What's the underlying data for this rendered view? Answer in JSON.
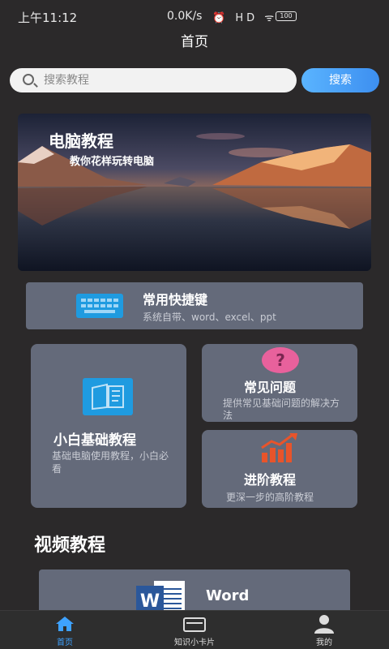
{
  "status_bar": {
    "time": "上午11:12",
    "network_speed": "0.0K/s",
    "icons": "⏰ HD ᯤ",
    "battery": "100"
  },
  "header": {
    "title": "首页"
  },
  "search": {
    "placeholder": "搜索教程",
    "button_label": "搜索"
  },
  "banner": {
    "title": "电脑教程",
    "subtitle": "教你花样玩转电脑"
  },
  "shortcuts_card": {
    "title": "常用快捷键",
    "subtitle": "系统自带、word、excel、ppt",
    "icon": "keyboard-icon"
  },
  "basics_card": {
    "title": "小白基础教程",
    "subtitle": "基础电脑使用教程，小白必看",
    "icon": "book-icon"
  },
  "faq_card": {
    "title": "常见问题",
    "subtitle": "提供常见基础问题的解决方法",
    "icon": "question-icon",
    "icon_glyph": "?"
  },
  "advanced_card": {
    "title": "进阶教程",
    "subtitle": "更深一步的高阶教程",
    "icon": "chart-icon"
  },
  "video_section": {
    "title": "视频教程",
    "items": [
      {
        "label": "Word",
        "icon": "word-icon"
      }
    ]
  },
  "tabbar": {
    "items": [
      {
        "label": "首页",
        "icon": "home-icon",
        "active": true
      },
      {
        "label": "知识小卡片",
        "icon": "card-icon",
        "active": false
      },
      {
        "label": "我的",
        "icon": "user-icon",
        "active": false
      }
    ]
  },
  "colors": {
    "accent": "#3ea2ff",
    "card": "#646a7a",
    "background": "#2b292a",
    "faq_icon": "#e8619c",
    "advanced_icon": "#e8542b"
  }
}
